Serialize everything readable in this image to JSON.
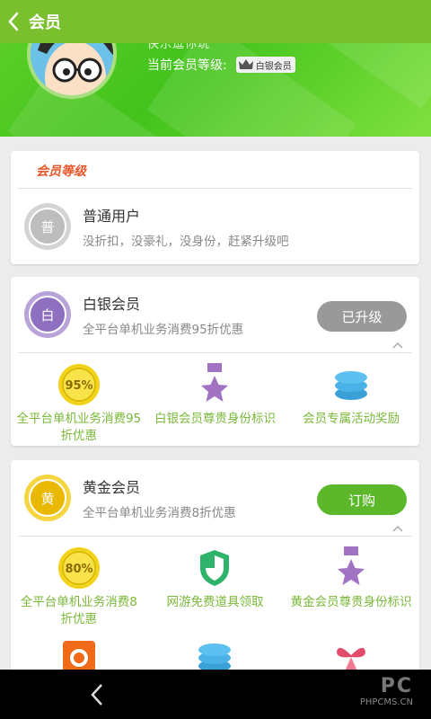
{
  "topbar": {
    "title": "会员",
    "back_icon": "chevron-left-icon"
  },
  "profile": {
    "username": "快乐逗你玩",
    "level_label": "当前会员等级:",
    "level_badge": "白银会员"
  },
  "levels_section": {
    "header": "会员等级"
  },
  "normal_user": {
    "medal_char": "普",
    "name": "普通用户",
    "desc": "没折扣，没豪礼，没身份，赶紧升级吧"
  },
  "silver": {
    "medal_char": "白",
    "name": "白银会员",
    "desc": "全平台单机业务消费95折优惠",
    "button": "已升级",
    "perks": [
      {
        "icon": "95-percent-medal-icon",
        "badge_text": "95%",
        "label": "全平台单机业务消费95折优惠"
      },
      {
        "icon": "purple-star-medal-icon",
        "label": "白银会员尊贵身份标识"
      },
      {
        "icon": "coin-stack-icon",
        "label": "会员专属活动奖励"
      }
    ]
  },
  "gold": {
    "medal_char": "黄",
    "name": "黄金会员",
    "desc": "全平台单机业务消费8折优惠",
    "button": "订购",
    "perks": [
      {
        "icon": "80-percent-medal-icon",
        "badge_text": "80%",
        "label": "全平台单机业务消费8折优惠"
      },
      {
        "icon": "green-shield-icon",
        "label": "网游免费道具领取"
      },
      {
        "icon": "purple-star-medal-icon",
        "label": "黄金会员尊贵身份标识"
      }
    ],
    "more_perk_icons": [
      "orange-camera-icon",
      "coin-stack-icon",
      "gift-bow-icon"
    ]
  },
  "navbar": {
    "back_icon": "nav-back-icon"
  },
  "watermark": {
    "logo": "PC",
    "site": "PHPCMS.CN"
  },
  "colors": {
    "accent_green": "#5cb82a",
    "header_green": "#7abf2e",
    "perk_text": "#7ab83a",
    "section_red": "#e8572d"
  }
}
